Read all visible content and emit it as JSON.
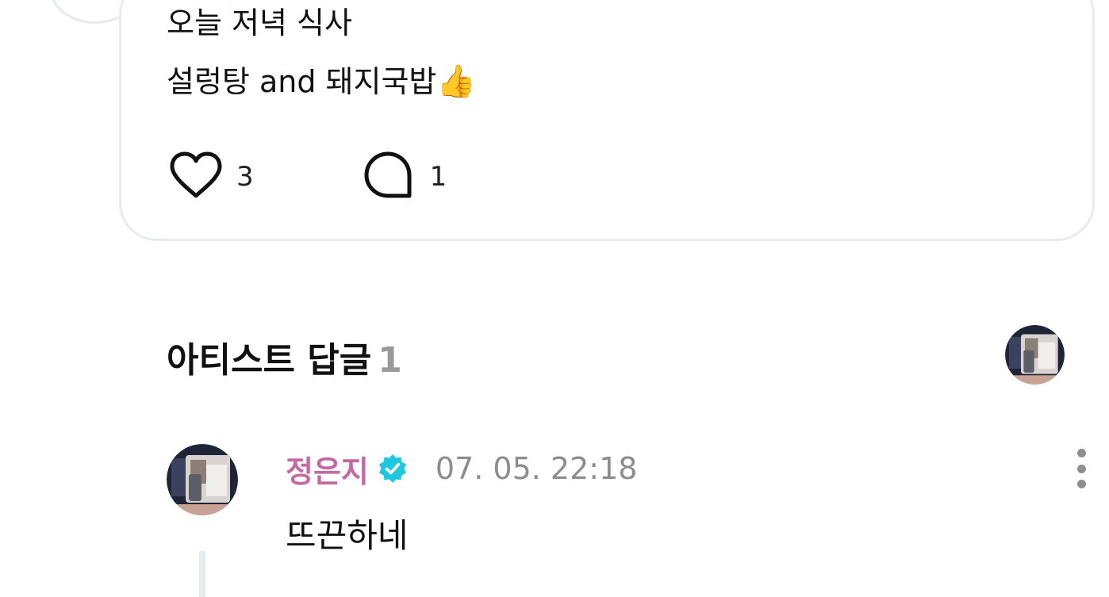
{
  "post": {
    "lines": [
      "오늘 저녁 식사",
      "설렁탕 and 돼지국밥"
    ],
    "emoji": "👍",
    "likes": "3",
    "comments": "1",
    "like_icon": "heart-outline-icon",
    "comment_icon": "speech-bubble-outline-icon"
  },
  "artist_replies": {
    "title": "아티스트 답글",
    "count": "1"
  },
  "reply": {
    "author": "정은지",
    "author_color": "#c468a4",
    "verified_icon": "verified-badge-icon",
    "verified_color": "#1ec8e0",
    "timestamp": "07. 05. 22:18",
    "text": "뜨끈하네",
    "menu_icon": "more-vertical-icon"
  }
}
